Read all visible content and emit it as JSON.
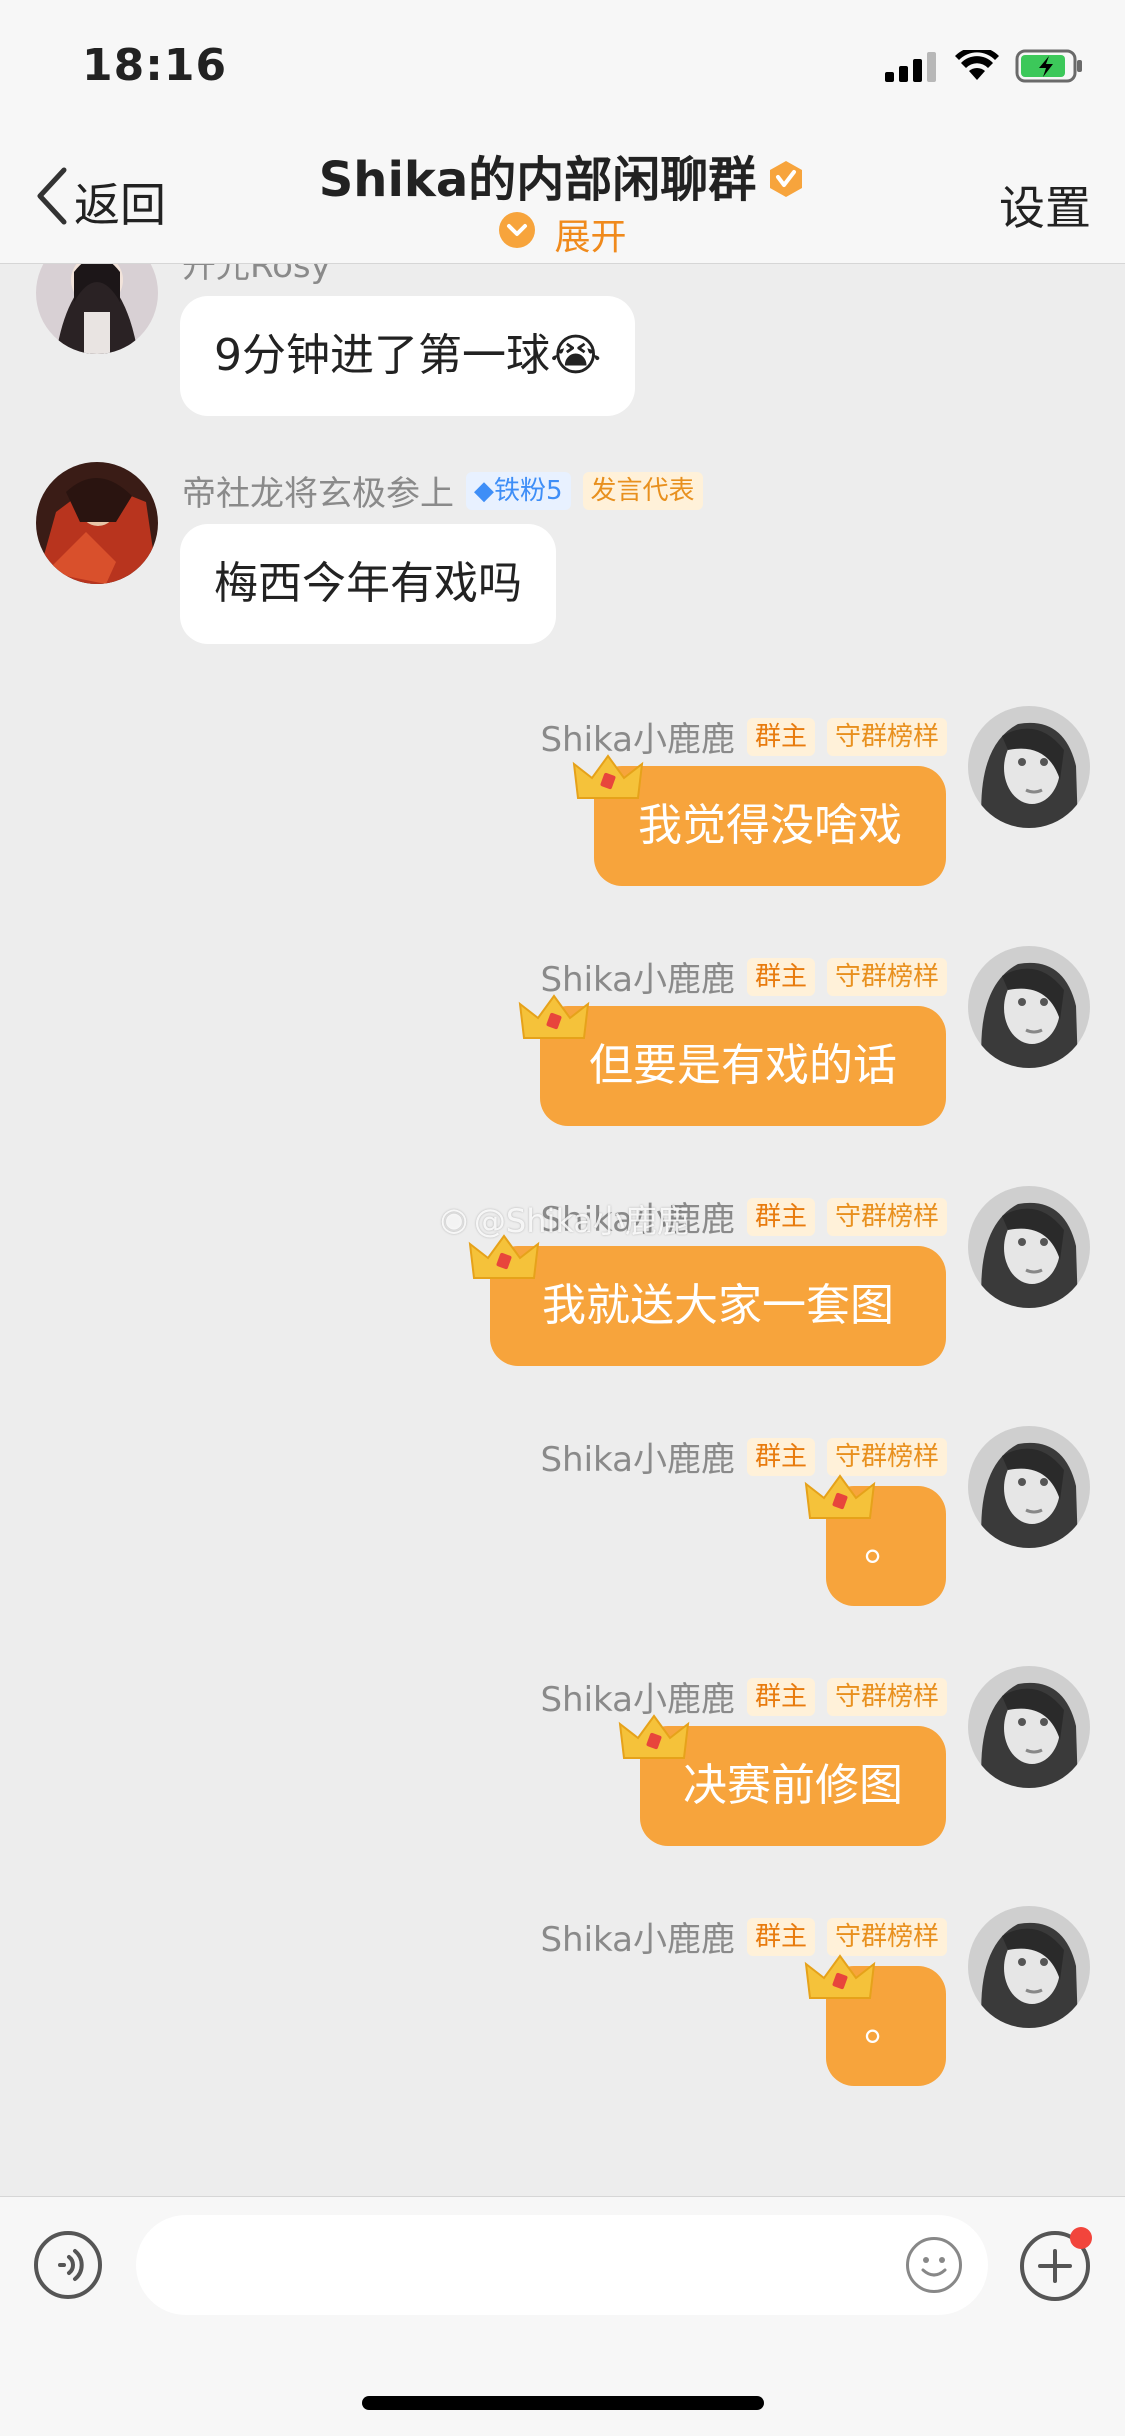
{
  "status_bar": {
    "time": "18:16"
  },
  "nav": {
    "back_label": "返回",
    "title": "Shika的内部闲聊群",
    "expand_label": "展开",
    "settings_label": "设置"
  },
  "messages": [
    {
      "side": "left",
      "name": "开光Rosy",
      "badges": [],
      "text": "9分钟进了第一球😭"
    },
    {
      "side": "left",
      "name": "帝社龙将玄极参上",
      "badges": [
        "铁粉5",
        "发言代表"
      ],
      "text": "梅西今年有戏吗"
    },
    {
      "side": "right",
      "name": "Shika小鹿鹿",
      "badges": [
        "群主",
        "守群榜样"
      ],
      "text": "我觉得没啥戏"
    },
    {
      "side": "right",
      "name": "Shika小鹿鹿",
      "badges": [
        "群主",
        "守群榜样"
      ],
      "text": "但要是有戏的话"
    },
    {
      "side": "right",
      "name": "Shika小鹿鹿",
      "badges": [
        "群主",
        "守群榜样"
      ],
      "text": "我就送大家一套图"
    },
    {
      "side": "right",
      "name": "Shika小鹿鹿",
      "badges": [
        "群主",
        "守群榜样"
      ],
      "text": "。"
    },
    {
      "side": "right",
      "name": "Shika小鹿鹿",
      "badges": [
        "群主",
        "守群榜样"
      ],
      "text": "决赛前修图"
    },
    {
      "side": "right",
      "name": "Shika小鹿鹿",
      "badges": [
        "群主",
        "守群榜样"
      ],
      "text": "。"
    }
  ],
  "watermark": "@Shika小鹿鹿",
  "colors": {
    "accent": "#f7a43c",
    "badge_text": "#e8901e",
    "fan_badge": "#3e8ef7"
  },
  "icons": [
    "signal-icon",
    "wifi-icon",
    "battery-icon",
    "back-chevron-icon",
    "verified-icon",
    "expand-icon",
    "voice-icon",
    "emoji-icon",
    "plus-icon",
    "crown-icon",
    "weibo-icon"
  ]
}
